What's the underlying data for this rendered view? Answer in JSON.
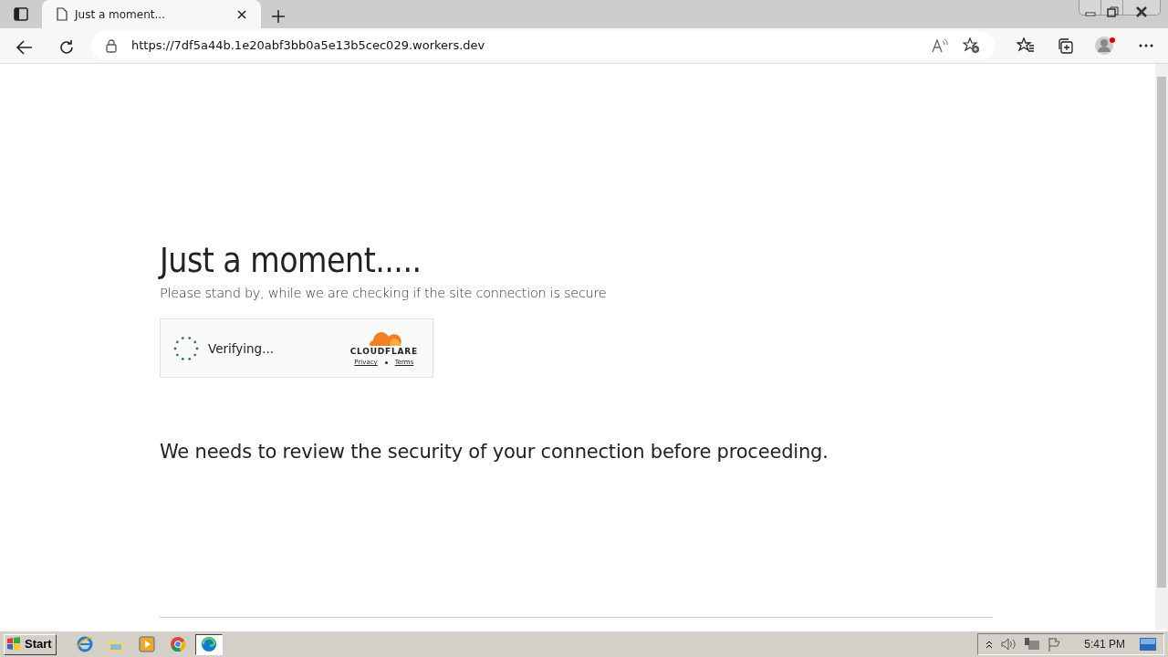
{
  "browser": {
    "tabs": [
      {
        "title": "Just a moment...",
        "selected": true
      }
    ],
    "url": "https://7df5a44b.1e20abf3bb0a5e13b5cec029.workers.dev"
  },
  "page": {
    "heading": "Just a moment.....",
    "subheading": "Please stand by, while we are checking if the site connection is secure",
    "widget": {
      "status": "Verifying...",
      "brand": "CLOUDFLARE",
      "links": [
        "Privacy",
        "Terms"
      ]
    },
    "message": "We needs to review the security of your connection before proceeding."
  },
  "taskbar": {
    "start": "Start",
    "apps": [
      {
        "kind": "ie",
        "selected": false
      },
      {
        "kind": "folder",
        "selected": false
      },
      {
        "kind": "media",
        "selected": false
      },
      {
        "kind": "chrome",
        "selected": false
      },
      {
        "kind": "edge",
        "selected": true
      }
    ],
    "clock": "5:41 PM"
  }
}
